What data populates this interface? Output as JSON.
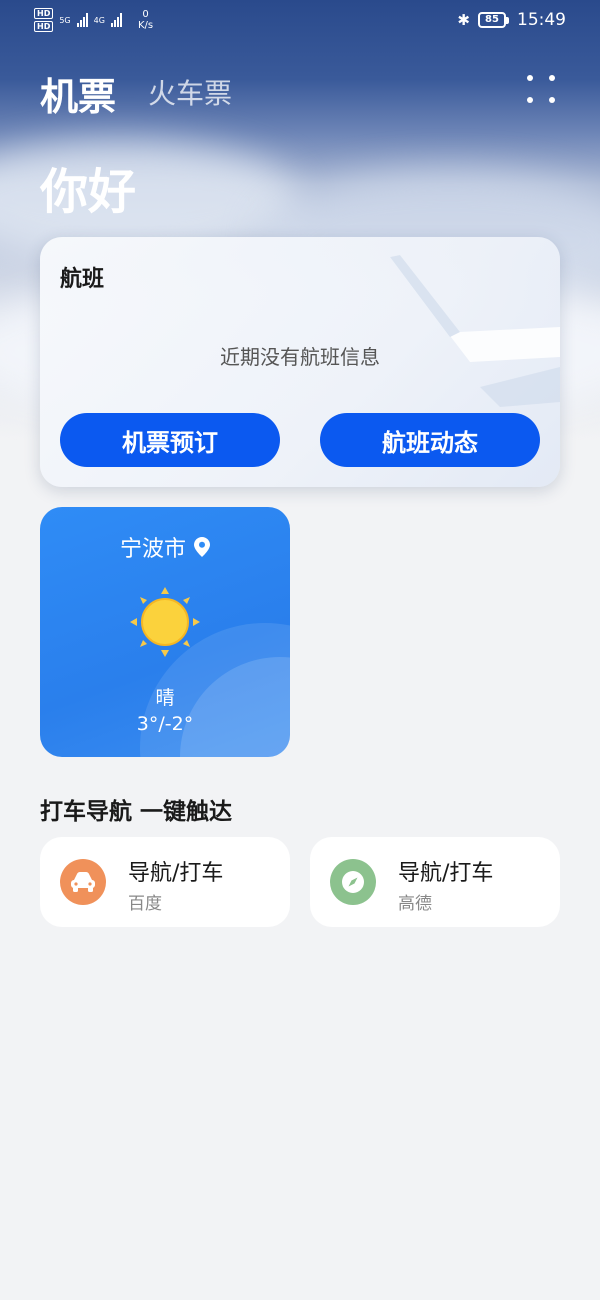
{
  "status_bar": {
    "hd1": "HD",
    "hd2": "HD",
    "net1": "5G",
    "net2": "4G",
    "speed_value": "0",
    "speed_unit": "K/s",
    "battery": "85",
    "time": "15:49"
  },
  "header": {
    "tab_active": "机票",
    "tab_inactive": "火车票",
    "greeting": "你好"
  },
  "flight_card": {
    "title": "航班",
    "empty_text": "近期没有航班信息",
    "book_button": "机票预订",
    "status_button": "航班动态"
  },
  "weather": {
    "city": "宁波市",
    "condition": "晴",
    "temperature": "3°/-2°",
    "icon": "sun-icon"
  },
  "nav_section": {
    "title": "打车导航 一键触达",
    "items": [
      {
        "label": "导航/打车",
        "provider": "百度",
        "icon": "car-icon",
        "color": "#f0915a"
      },
      {
        "label": "导航/打车",
        "provider": "高德",
        "icon": "compass-icon",
        "color": "#8cc28e"
      }
    ]
  },
  "colors": {
    "accent": "#0b59f0",
    "weather_bg": "#2f8cf6",
    "page_bg": "#f2f3f5"
  }
}
